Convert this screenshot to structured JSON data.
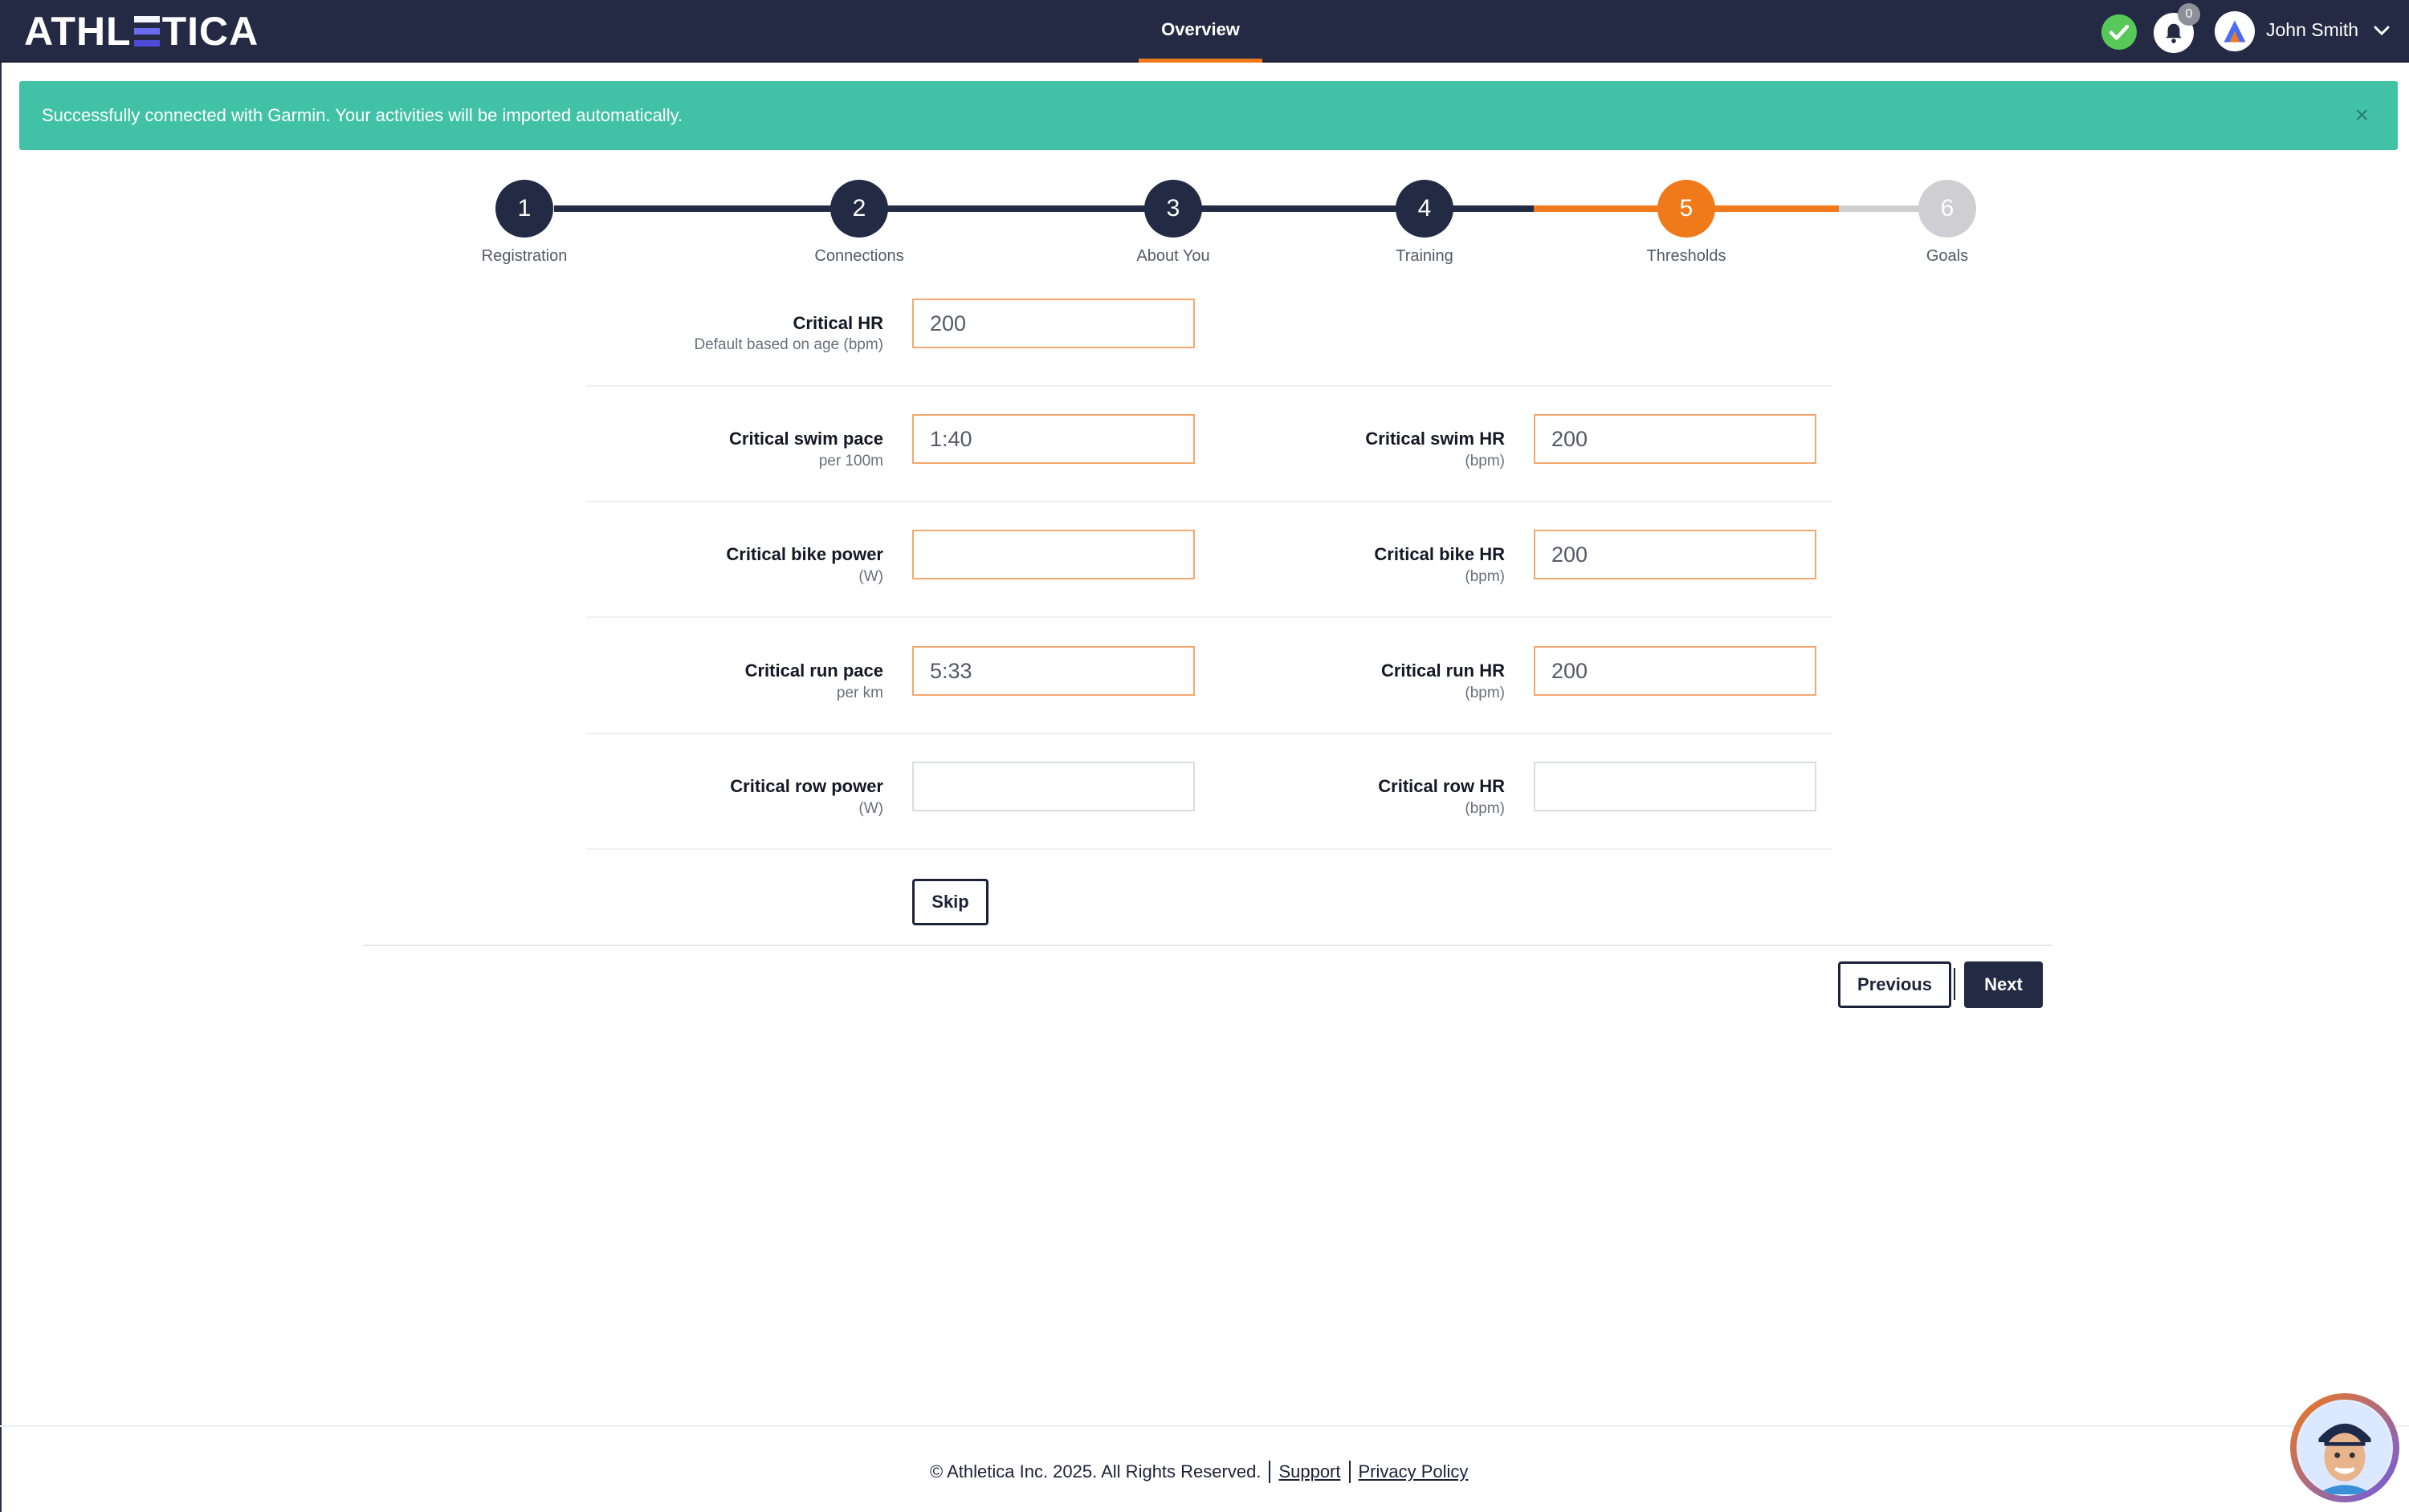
{
  "app": {
    "name": "ATHLETICA",
    "name_prefix": "ATHL",
    "name_suffix": "TICA"
  },
  "header": {
    "nav_tab": "Overview",
    "notifications_count": "0",
    "user_name": "John Smith"
  },
  "alert": {
    "message": "Successfully connected with Garmin. Your activities will be imported automatically.",
    "close_symbol": "×"
  },
  "stepper": {
    "steps": [
      {
        "number": "1",
        "label": "Registration",
        "state": "done"
      },
      {
        "number": "2",
        "label": "Connections",
        "state": "done"
      },
      {
        "number": "3",
        "label": "About You",
        "state": "done"
      },
      {
        "number": "4",
        "label": "Training",
        "state": "done"
      },
      {
        "number": "5",
        "label": "Thresholds",
        "state": "active"
      },
      {
        "number": "6",
        "label": "Goals",
        "state": "todo"
      }
    ],
    "colors": {
      "done": "#232a44",
      "active": "#f07a1a",
      "todo": "#cfcfd3"
    }
  },
  "form": {
    "critical_hr": {
      "label": "Critical HR",
      "sublabel": "Default based on age (bpm)",
      "value": "200"
    },
    "swim_pace": {
      "label": "Critical swim pace",
      "sublabel": "per 100m",
      "value": "1:40"
    },
    "swim_hr": {
      "label": "Critical swim HR",
      "sublabel": "(bpm)",
      "value": "200"
    },
    "bike_power": {
      "label": "Critical bike power",
      "sublabel": "(W)",
      "value": ""
    },
    "bike_hr": {
      "label": "Critical bike HR",
      "sublabel": "(bpm)",
      "value": "200"
    },
    "run_pace": {
      "label": "Critical run pace",
      "sublabel": "per km",
      "value": "5:33"
    },
    "run_hr": {
      "label": "Critical run HR",
      "sublabel": "(bpm)",
      "value": "200"
    },
    "row_power": {
      "label": "Critical row power",
      "sublabel": "(W)",
      "value": ""
    },
    "row_hr": {
      "label": "Critical row HR",
      "sublabel": "(bpm)",
      "value": ""
    },
    "skip_label": "Skip"
  },
  "nav_buttons": {
    "previous": "Previous",
    "next": "Next"
  },
  "footer": {
    "copyright": "© Athletica Inc. 2025. All Rights Reserved.",
    "support": "Support",
    "privacy": "Privacy Policy"
  },
  "icons": {
    "status": "check-circle-icon",
    "notifications": "bell-icon",
    "user_menu": "chevron-down-icon",
    "help": "assistant-avatar-icon"
  },
  "colors": {
    "navbar": "#242a43",
    "alert": "#41c2a6",
    "accent": "#f07a1a",
    "status_ok": "#57c95a"
  }
}
